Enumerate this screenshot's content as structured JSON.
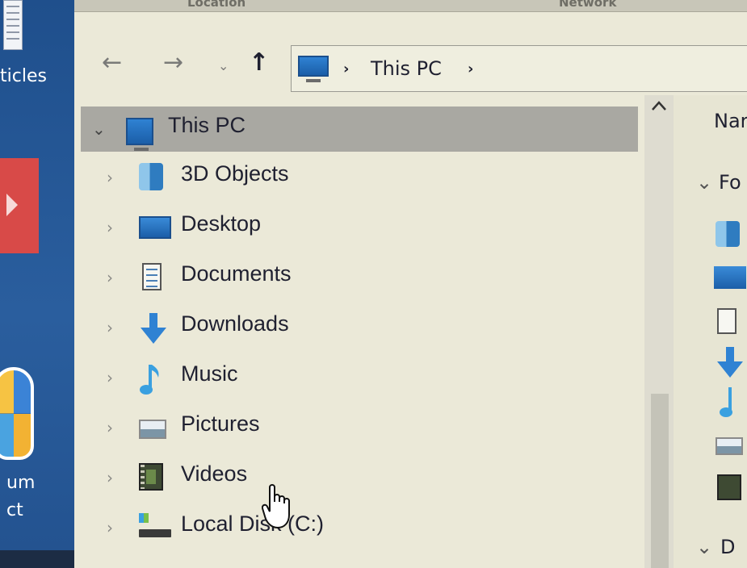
{
  "desktop": {
    "label_top": "ticles",
    "label_bottom_1": "um",
    "label_bottom_2": "ct"
  },
  "ribbon": {
    "left_label": "Location",
    "right_label": "Network"
  },
  "navigation": {
    "back": "←",
    "forward": "→",
    "recent": "⌄",
    "up": "↑"
  },
  "address_bar": {
    "crumb_1": "This PC",
    "separator": "›",
    "trailing_separator": "›"
  },
  "tree": {
    "root": {
      "label": "This PC",
      "chevron": "⌄"
    },
    "items": [
      {
        "label": "3D Objects",
        "icon": "3d-objects-icon"
      },
      {
        "label": "Desktop",
        "icon": "desktop-folder-icon"
      },
      {
        "label": "Documents",
        "icon": "documents-icon"
      },
      {
        "label": "Downloads",
        "icon": "downloads-icon"
      },
      {
        "label": "Music",
        "icon": "music-icon"
      },
      {
        "label": "Pictures",
        "icon": "pictures-icon"
      },
      {
        "label": "Videos",
        "icon": "videos-icon"
      },
      {
        "label": "Local Disk (C:)",
        "icon": "local-disk-icon"
      }
    ],
    "chevron": "›"
  },
  "right_pane": {
    "column_header": "Nar",
    "group_1": "Fo",
    "group_2": "D",
    "group_chevron": "⌄"
  },
  "colors": {
    "accent_blue": "#2f82d3",
    "selected_row": "#a9a8a2",
    "window_bg": "#ebe9d8"
  }
}
